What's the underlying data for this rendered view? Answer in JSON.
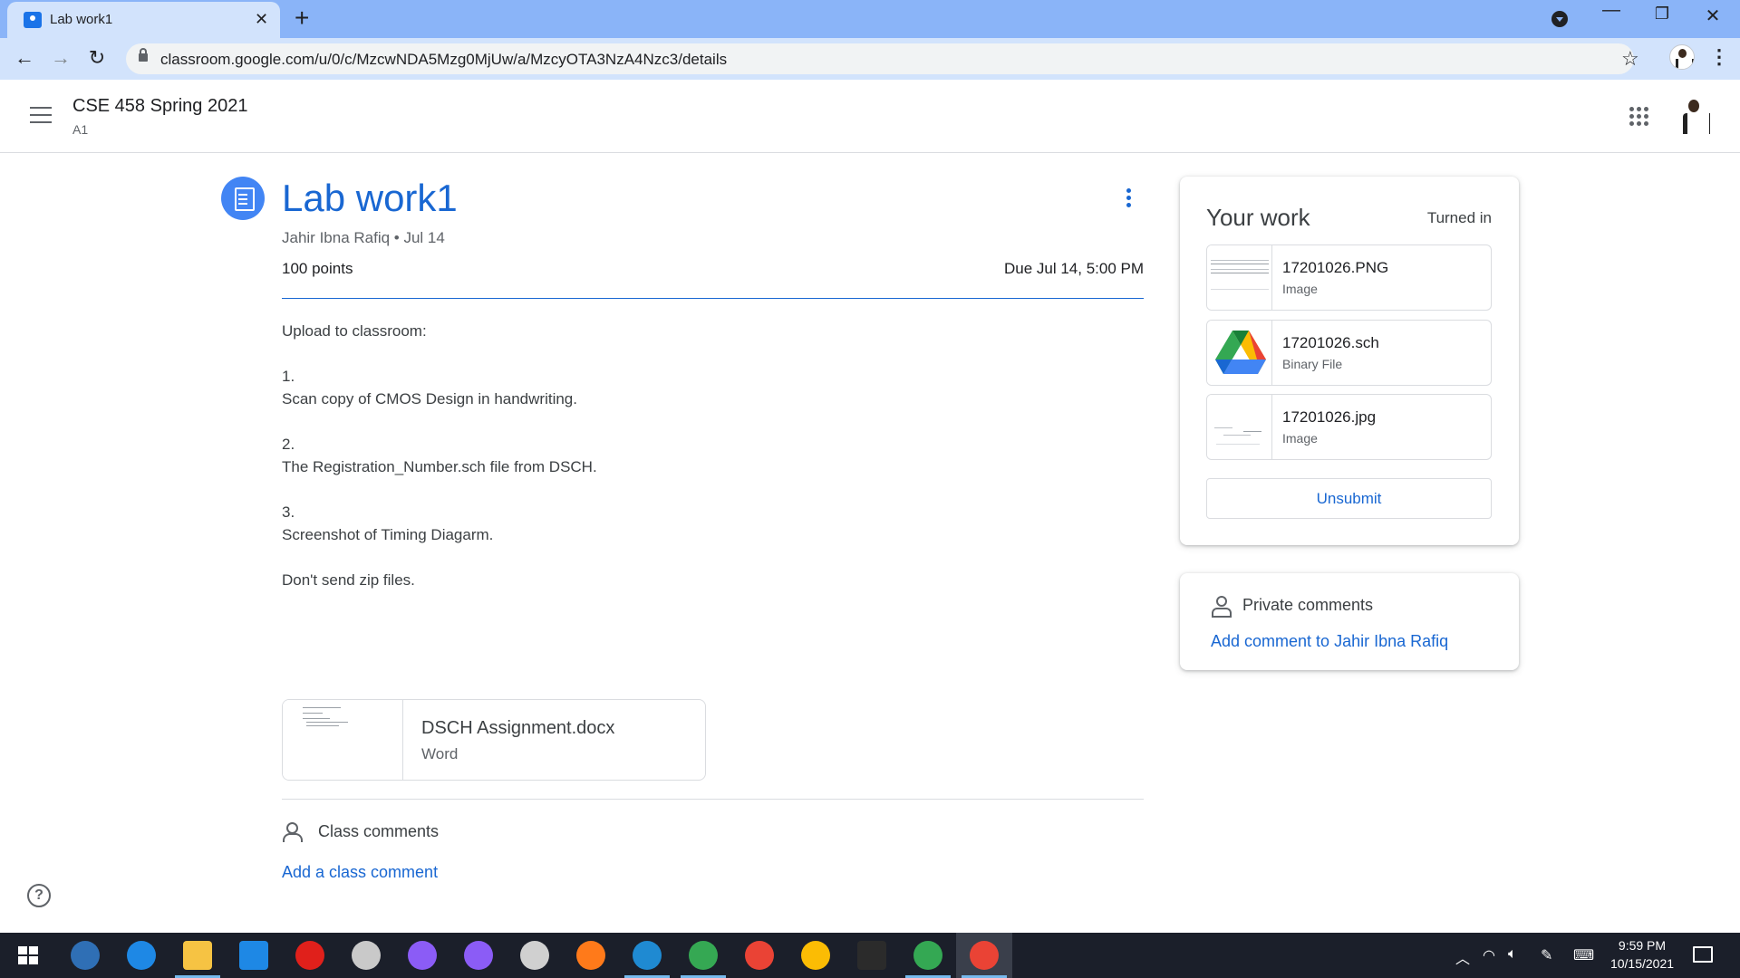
{
  "browser": {
    "tab_title": "Lab work1",
    "url": "classroom.google.com/u/0/c/MzcwNDA5Mzg0MjUw/a/MzcyOTA3NzA4Nzc3/details"
  },
  "header": {
    "class_name": "CSE 458 Spring 2021",
    "section": "A1"
  },
  "assignment": {
    "title": "Lab work1",
    "meta": "Jahir Ibna Rafiq • Jul 14",
    "points": "100 points",
    "due": "Due Jul 14, 5:00 PM",
    "instructions": [
      "Upload to classroom:",
      "",
      "1.",
      "Scan copy of CMOS Design in handwriting.",
      "",
      "2.",
      "The Registration_Number.sch file from DSCH.",
      "",
      "3.",
      "Screenshot of Timing Diagarm.",
      "",
      "Don't send zip files."
    ],
    "attachment": {
      "name": "DSCH Assignment.docx",
      "type": "Word"
    }
  },
  "class_comments": {
    "label": "Class comments",
    "add_label": "Add a class comment"
  },
  "your_work": {
    "title": "Your work",
    "status": "Turned in",
    "files": [
      {
        "name": "17201026.PNG",
        "type": "Image",
        "icon": "image-thumbnail"
      },
      {
        "name": "17201026.sch",
        "type": "Binary File",
        "icon": "google-drive-icon"
      },
      {
        "name": "17201026.jpg",
        "type": "Image",
        "icon": "image-thumbnail"
      }
    ],
    "unsubmit_label": "Unsubmit"
  },
  "private_comments": {
    "label": "Private comments",
    "add_label": "Add comment to Jahir Ibna Rafiq"
  },
  "taskbar": {
    "time": "9:59 PM",
    "date": "10/15/2021",
    "apps": [
      {
        "name": "qbittorrent",
        "color": "#2f6fb5"
      },
      {
        "name": "edge",
        "color": "#1e88e5"
      },
      {
        "name": "file-explorer",
        "color": "#f6c343"
      },
      {
        "name": "mail",
        "color": "#1e88e5"
      },
      {
        "name": "opera",
        "color": "#e0201b"
      },
      {
        "name": "dsch",
        "color": "#c9c9c9"
      },
      {
        "name": "messenger",
        "color": "#8b5cf6"
      },
      {
        "name": "github",
        "color": "#8b5cf6"
      },
      {
        "name": "microwind",
        "color": "#d0d0d0"
      },
      {
        "name": "firefox",
        "color": "#ff7a1a"
      },
      {
        "name": "vscode",
        "color": "#1f8ad2"
      },
      {
        "name": "globe-app",
        "color": "#35a853"
      },
      {
        "name": "chrome",
        "color": "#ea4335"
      },
      {
        "name": "chrome",
        "color": "#fbbc04"
      },
      {
        "name": "terminal",
        "color": "#2b2b2b"
      },
      {
        "name": "chrome",
        "color": "#34a853"
      },
      {
        "name": "chrome",
        "color": "#ea4335"
      }
    ]
  }
}
